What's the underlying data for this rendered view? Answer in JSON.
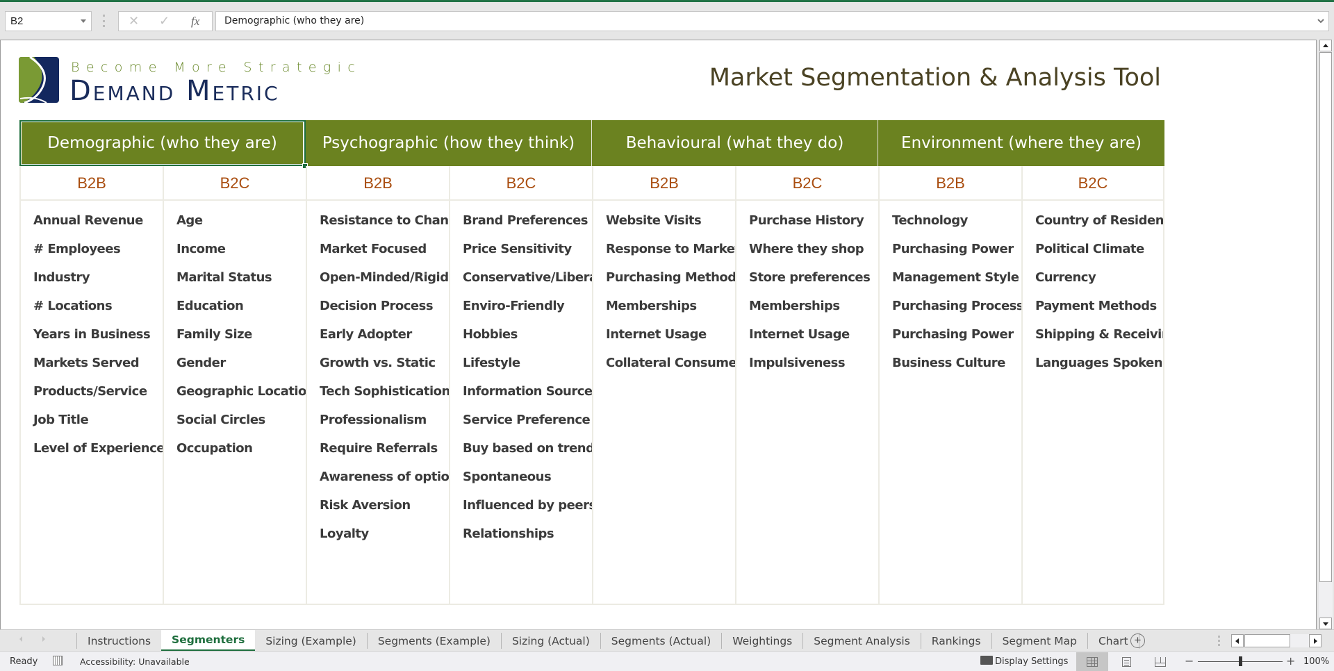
{
  "formula_bar": {
    "name_box": "B2",
    "cancel_icon": "✕",
    "enter_icon": "✓",
    "fx_label": "fx",
    "formula": "Demographic (who they are)"
  },
  "logo": {
    "tagline": "Become More Strategic",
    "brand": "Demand Metric"
  },
  "title": "Market Segmentation & Analysis Tool",
  "colors": {
    "header_green": "#6b8220",
    "subheader_orange": "#a94d0f",
    "excel_green": "#217346"
  },
  "categories": [
    {
      "label": "Demographic (who they are)",
      "columns": [
        {
          "type": "B2B",
          "items": [
            "Annual Revenue",
            "# Employees",
            "Industry",
            "# Locations",
            "Years in Business",
            "Markets Served",
            "Products/Service",
            "Job Title",
            "Level of Experience"
          ]
        },
        {
          "type": "B2C",
          "items": [
            "Age",
            "Income",
            "Marital Status",
            "Education",
            "Family Size",
            "Gender",
            "Geographic Location",
            "Social Circles",
            "Occupation"
          ]
        }
      ]
    },
    {
      "label": "Psychographic (how they think)",
      "columns": [
        {
          "type": "B2B",
          "items": [
            "Resistance to Change",
            "Market Focused",
            "Open-Minded/Rigid",
            "Decision Process",
            "Early Adopter",
            "Growth vs. Static",
            "Tech Sophistication",
            "Professionalism",
            "Require Referrals",
            "Awareness of options",
            "Risk Aversion",
            "Loyalty"
          ]
        },
        {
          "type": "B2C",
          "items": [
            "Brand Preferences",
            "Price Sensitivity",
            "Conservative/Liberal",
            "Enviro-Friendly",
            "Hobbies",
            "Lifestyle",
            "Information Sources",
            "Service Preference",
            "Buy based on trends",
            "Spontaneous",
            "Influenced by peers",
            "Relationships"
          ]
        }
      ]
    },
    {
      "label": "Behavioural (what they do)",
      "columns": [
        {
          "type": "B2B",
          "items": [
            "Website Visits",
            "Response to Marketing",
            "Purchasing Methods",
            "Memberships",
            "Internet Usage",
            "Collateral Consumed"
          ]
        },
        {
          "type": "B2C",
          "items": [
            "Purchase History",
            "Where they shop",
            "Store preferences",
            "Memberships",
            "Internet Usage",
            "Impulsiveness"
          ]
        }
      ]
    },
    {
      "label": "Environment (where they are)",
      "columns": [
        {
          "type": "B2B",
          "items": [
            "Technology",
            "Purchasing Power",
            "Management Style",
            "Purchasing Process",
            "Purchasing Power",
            "Business Culture"
          ]
        },
        {
          "type": "B2C",
          "items": [
            "Country of Residence",
            "Political Climate",
            "Currency",
            "Payment Methods",
            "Shipping & Receiving",
            "Languages Spoken"
          ]
        }
      ]
    }
  ],
  "sheet_tabs": {
    "active": "Segmenters",
    "tabs": [
      "Instructions",
      "Segmenters",
      "Sizing (Example)",
      "Segments (Example)",
      "Sizing (Actual)",
      "Segments (Actual)",
      "Weightings",
      "Segment Analysis",
      "Rankings",
      "Segment Map",
      "Chart"
    ],
    "add_icon": "+"
  },
  "status_bar": {
    "ready": "Ready",
    "accessibility": "Accessibility: Unavailable",
    "display_settings": "Display Settings",
    "zoom_minus": "−",
    "zoom_plus": "+",
    "zoom_level": "100%",
    "zoom_fraction": 0.5
  }
}
